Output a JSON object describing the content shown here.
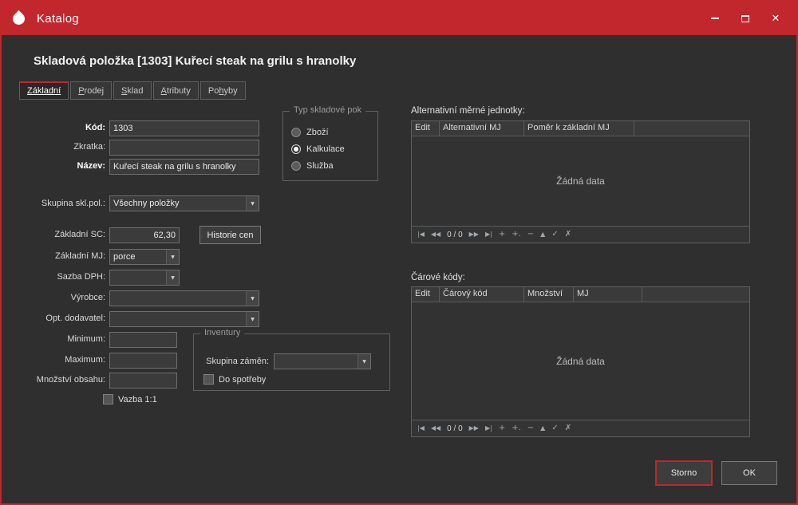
{
  "window": {
    "title": "Katalog",
    "close_icon": "✕"
  },
  "heading": "Skladová položka [1303] Kuřecí steak na grilu s hranolky",
  "tabs": [
    {
      "label": "Základní",
      "active": true
    },
    {
      "label": "Prodej",
      "active": false
    },
    {
      "label": "Sklad",
      "active": false
    },
    {
      "label": "Atributy",
      "active": false
    },
    {
      "label": "Pohyby",
      "active": false
    }
  ],
  "form": {
    "kod": {
      "label": "Kód:",
      "value": "1303"
    },
    "zkratka": {
      "label": "Zkratka:",
      "value": ""
    },
    "nazev": {
      "label": "Název:",
      "value": "Kuřecí steak na grilu s hranolky"
    },
    "skupina_skl_pol": {
      "label": "Skupina skl.pol.:",
      "value": "Všechny položky"
    },
    "zakladni_sc": {
      "label": "Základní SC:",
      "value": "62,30"
    },
    "historie_cen_button": "Historie cen",
    "zakladni_mj": {
      "label": "Základní MJ:",
      "value": "porce"
    },
    "sazba_dph": {
      "label": "Sazba DPH:",
      "value": ""
    },
    "vyrobce": {
      "label": "Výrobce:",
      "value": ""
    },
    "opt_dodavatel": {
      "label": "Opt. dodavatel:",
      "value": ""
    },
    "minimum": {
      "label": "Minimum:",
      "value": ""
    },
    "maximum": {
      "label": "Maximum:",
      "value": ""
    },
    "mnozstvi_obsahu": {
      "label": "Množství obsahu:",
      "value": ""
    },
    "vazba_1_1": {
      "label": "Vazba 1:1",
      "checked": false
    }
  },
  "typ_skladove_polozky": {
    "title": "Typ skladové pok",
    "options": [
      {
        "label": "Zboží",
        "selected": false
      },
      {
        "label": "Kalkulace",
        "selected": true
      },
      {
        "label": "Služba",
        "selected": false
      }
    ]
  },
  "inventury": {
    "title": "Inventury",
    "skupina_zamen": {
      "label": "Skupina záměn:",
      "value": ""
    },
    "do_spotreby": {
      "label": "Do spotřeby",
      "checked": false
    }
  },
  "alt_jednotky": {
    "title": "Alternativní měrné jednotky:",
    "columns": [
      "Edit",
      "Alternativní MJ",
      "Poměr k základní MJ"
    ],
    "empty_text": "Žádná data"
  },
  "carove_kody": {
    "title": "Čárové kódy:",
    "columns": [
      "Edit",
      "Čárový kód",
      "Množství",
      "MJ"
    ],
    "empty_text": "Žádná data"
  },
  "navigator": {
    "first": "|◀",
    "prev": "◀◀",
    "counter": "0 / 0",
    "next": "▶▶",
    "last": "▶|",
    "add": "+",
    "insert": "+.",
    "remove": "−",
    "edit": "▲",
    "accept": "✓",
    "cancel": "✗"
  },
  "footer": {
    "storno_button": "Storno",
    "ok_button": "OK"
  }
}
